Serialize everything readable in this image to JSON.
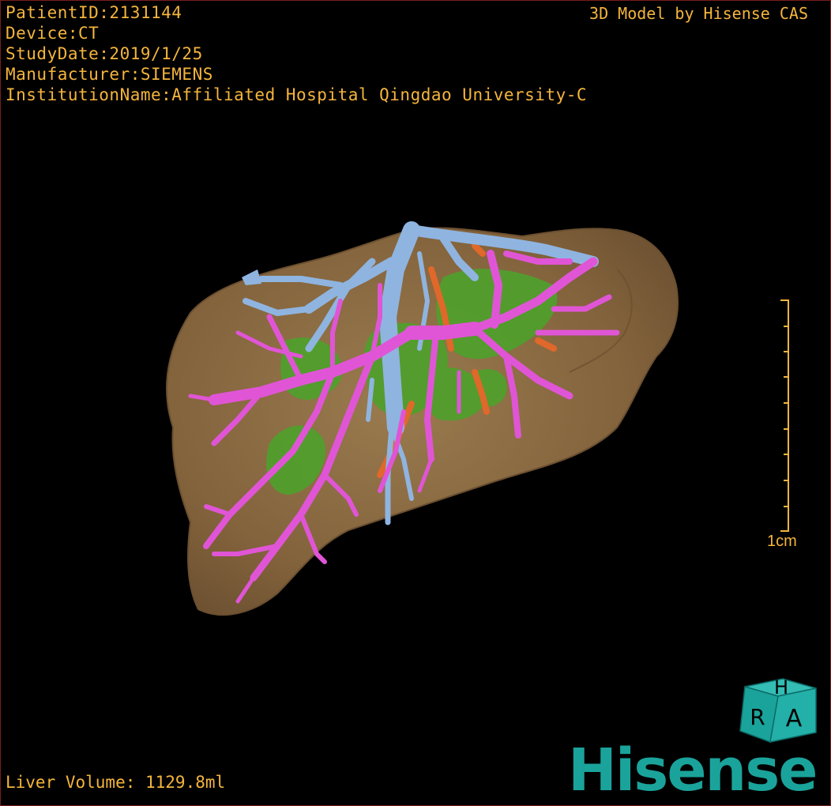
{
  "info": {
    "patient_id": "PatientID:2131144",
    "device": "Device:CT",
    "study_date": "StudyDate:2019/1/25",
    "manufacturer": "Manufacturer:SIEMENS",
    "institution": "InstitutionName:Affiliated Hospital Qingdao University-C"
  },
  "credit": "3D Model by Hisense CAS",
  "volume": "Liver Volume: 1129.8ml",
  "scale": {
    "label": "1cm"
  },
  "orientation_cube": {
    "top": "H",
    "front": "R",
    "right": "A"
  },
  "logo": "Hisense",
  "colors": {
    "text": "#f5b53d",
    "liver": "#8a6a42",
    "portal_vein": "#e055d6",
    "hepatic_vein": "#8fb4e0",
    "tumor": "#4fa02c",
    "artery": "#e0682a",
    "cube": "#1aa39b",
    "logo": "#1aa39b"
  }
}
